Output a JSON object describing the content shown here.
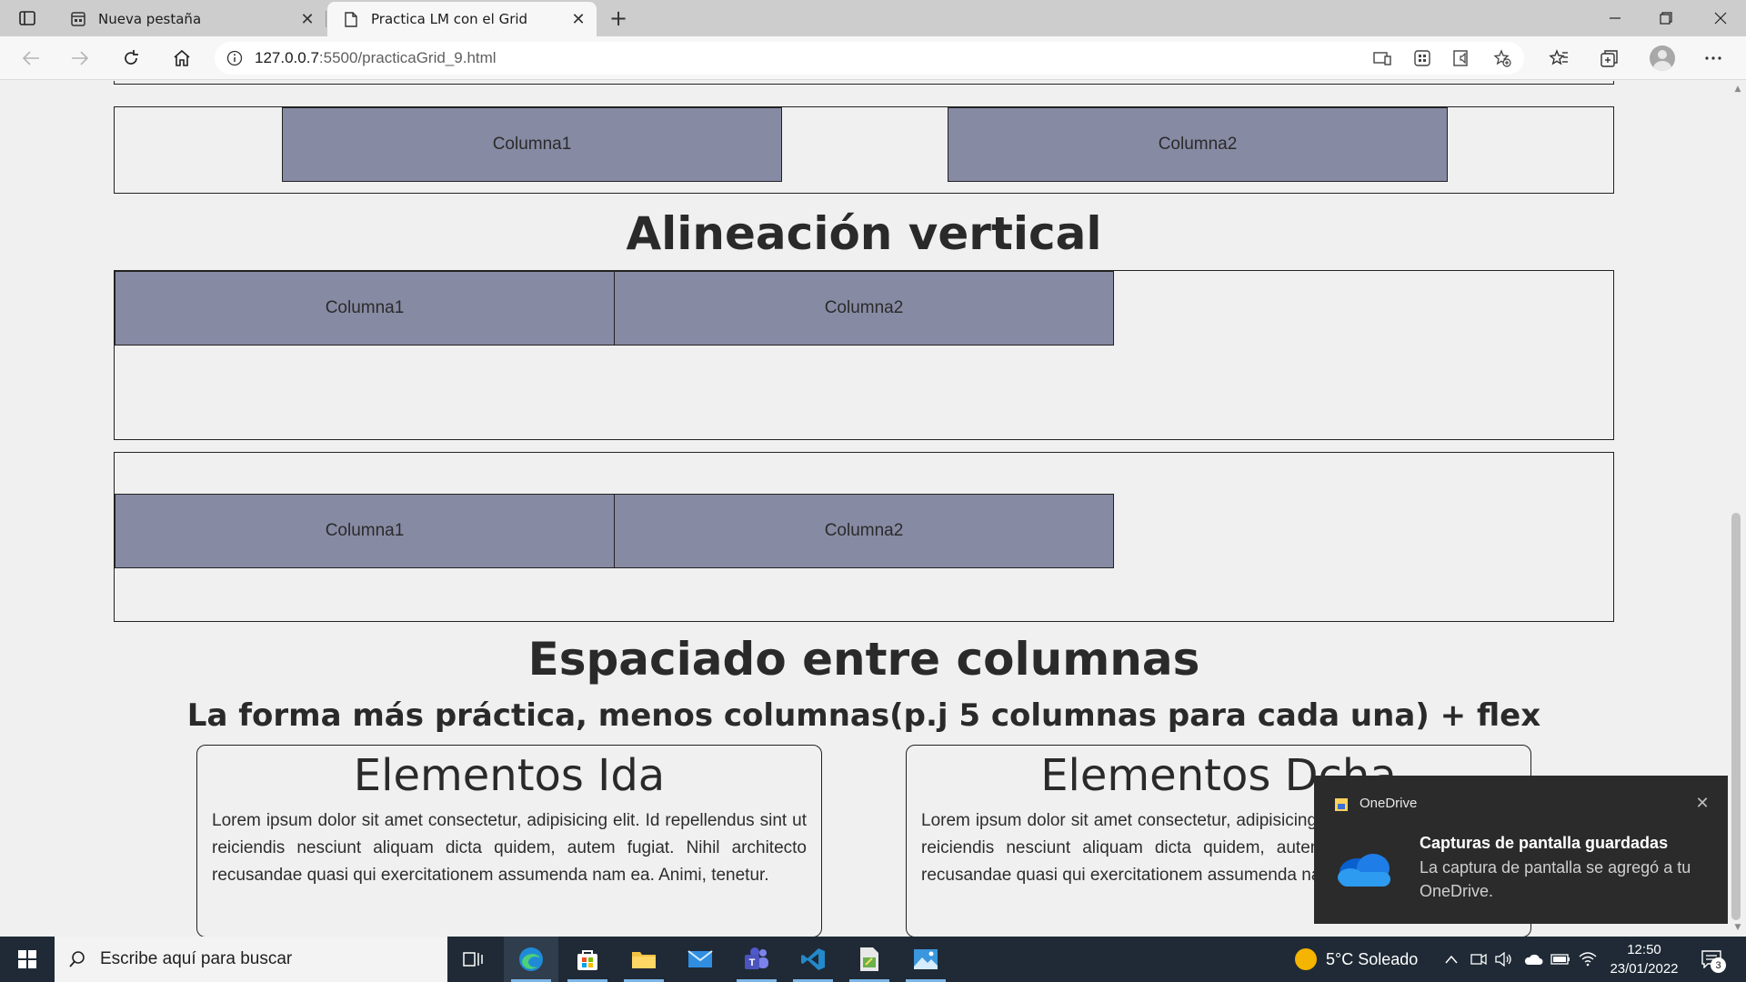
{
  "browser": {
    "tabs": [
      {
        "title": "Nueva pestaña",
        "active": false
      },
      {
        "title": "Practica LM con el Grid",
        "active": true
      }
    ],
    "address": {
      "host": "127.0.0.7",
      "path": ":5500/practicaGrid_9.html"
    }
  },
  "page": {
    "section1": {
      "col1": "Columna1",
      "col2": "Columna2"
    },
    "heading_vertical": "Alineación vertical",
    "section2": {
      "col1": "Columna1",
      "col2": "Columna2"
    },
    "section3": {
      "col1": "Columna1",
      "col2": "Columna2"
    },
    "heading_spacing": "Espaciado entre columnas",
    "subheading": "La forma más práctica, menos columnas(p.j 5 columnas para cada una) + flex",
    "cards": [
      {
        "title": "Elementos Ida",
        "text": "Lorem ipsum dolor sit amet consectetur, adipisicing elit. Id repellendus sint ut reiciendis nesciunt aliquam dicta quidem, autem fugiat. Nihil architecto recusandae quasi qui exercitationem assumenda nam ea. Animi, tenetur."
      },
      {
        "title": "Elementos Dcha",
        "text": "Lorem ipsum dolor sit amet consectetur, adipisicing elit. Id repellendus sint ut reiciendis nesciunt aliquam dicta quidem, autem fugiat. Nihil architecto recusandae quasi qui exercitationem assumenda nam ea. Animi, tenetur."
      }
    ]
  },
  "notification": {
    "app": "OneDrive",
    "title": "Capturas de pantalla guardadas",
    "body": "La captura de pantalla se agregó a tu OneDrive."
  },
  "taskbar": {
    "search_placeholder": "Escribe aquí para buscar",
    "weather": "5°C Soleado",
    "time": "12:50",
    "date": "23/01/2022",
    "notification_count": "3"
  },
  "colors": {
    "cell": "#878aa3",
    "taskbar": "#1f2a36",
    "toast": "#2b2b2b"
  }
}
